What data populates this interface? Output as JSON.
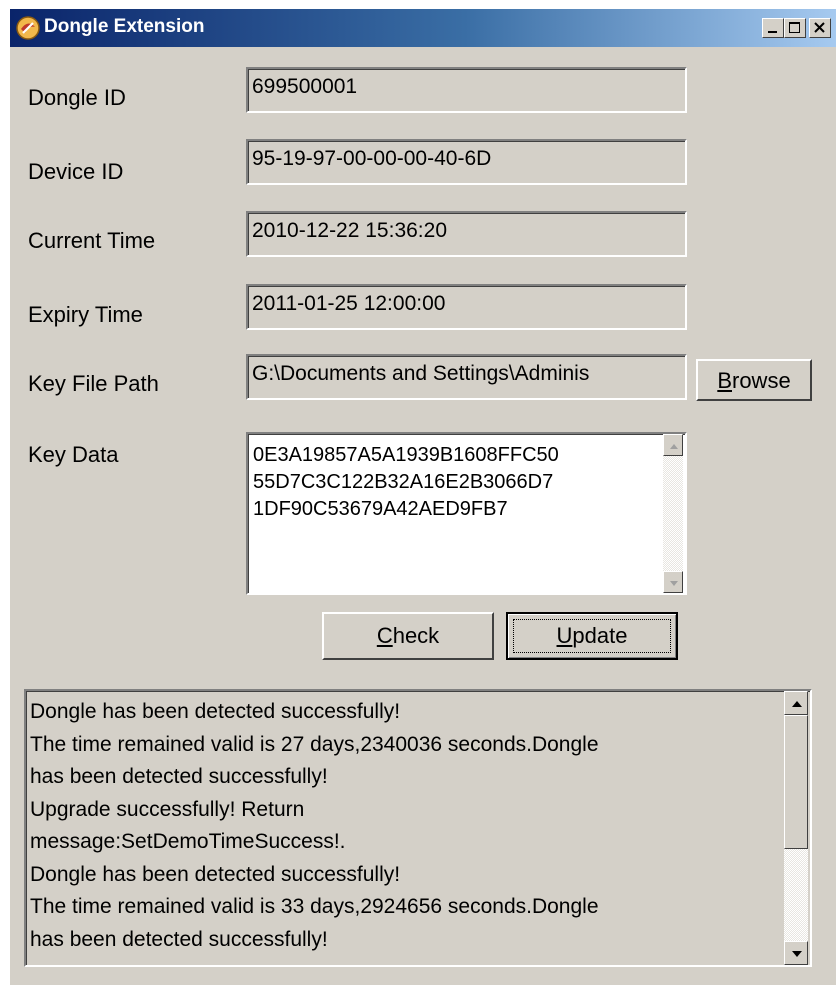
{
  "window": {
    "title": "Dongle Extension",
    "icon": "dongle-app-icon",
    "controls": [
      "minimize-icon",
      "maximize-icon",
      "close-icon"
    ]
  },
  "form": {
    "dongle_id": {
      "label": "Dongle ID",
      "value": "699500001"
    },
    "device_id": {
      "label": "Device ID",
      "value": "95-19-97-00-00-00-40-6D"
    },
    "current_time": {
      "label": "Current Time",
      "value": "2010-12-22 15:36:20"
    },
    "expiry_time": {
      "label": "Expiry Time",
      "value": "2011-01-25 12:00:00"
    },
    "key_file_path": {
      "label": "Key File Path",
      "value": "G:\\Documents and Settings\\Adminis"
    },
    "key_data": {
      "label": "Key Data",
      "value": "0E3A19857A5A1939B1608FFC50\n55D7C3C122B32A16E2B3066D7\n1DF90C53679A42AED9FB7"
    }
  },
  "buttons": {
    "browse": {
      "pre": "",
      "accel": "B",
      "post": "rowse"
    },
    "check": {
      "pre": "",
      "accel": "C",
      "post": "heck"
    },
    "update": {
      "pre": "",
      "accel": "U",
      "post": "pdate"
    }
  },
  "log": {
    "lines": "Dongle has been detected successfully!\nThe time remained valid is 27 days,2340036 seconds.Dongle\nhas been detected successfully!\nUpgrade successfully! Return\nmessage:SetDemoTimeSuccess!.\nDongle has been detected successfully!\nThe time remained valid is 33 days,2924656 seconds.Dongle\nhas been detected successfully!"
  },
  "colors": {
    "dialog_bg": "#d4d0c8",
    "titlebar_start": "#0a246a",
    "titlebar_end": "#a6caf0"
  }
}
